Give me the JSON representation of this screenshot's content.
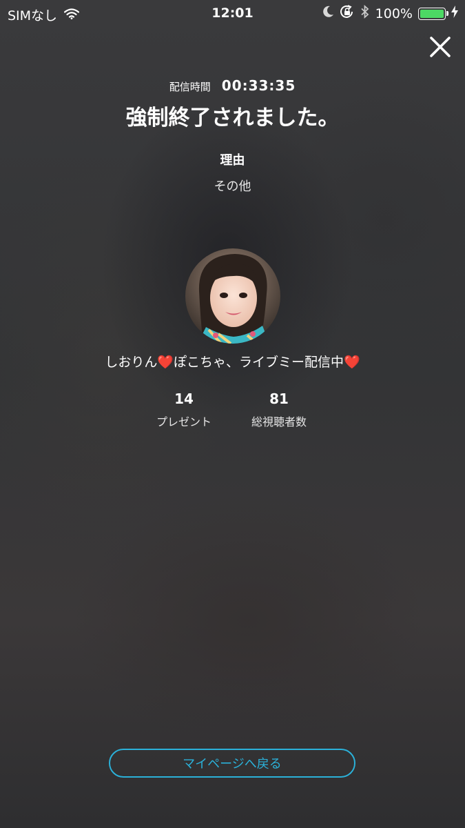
{
  "status_bar": {
    "carrier": "SIMなし",
    "time": "12:01",
    "battery_percent": "100%",
    "battery_level": 1.0,
    "battery_color": "#4cd964",
    "icons": [
      "wifi-icon",
      "moon-icon",
      "rotation-lock-icon",
      "bluetooth-icon",
      "battery-icon",
      "charging-icon"
    ]
  },
  "close_icon": "close-icon",
  "duration": {
    "label": "配信時間",
    "value": "00:33:35"
  },
  "title": "強制終了されました。",
  "reason": {
    "label": "理由",
    "value": "その他"
  },
  "broadcast": {
    "title": "しおりん❤️ぽこちゃ、ライブミー配信中❤️"
  },
  "stats": [
    {
      "value": "14",
      "label": "プレゼント"
    },
    {
      "value": "81",
      "label": "総視聴者数"
    }
  ],
  "mypage_button": {
    "label": "マイページへ戻る",
    "color": "#2bb1d9"
  }
}
